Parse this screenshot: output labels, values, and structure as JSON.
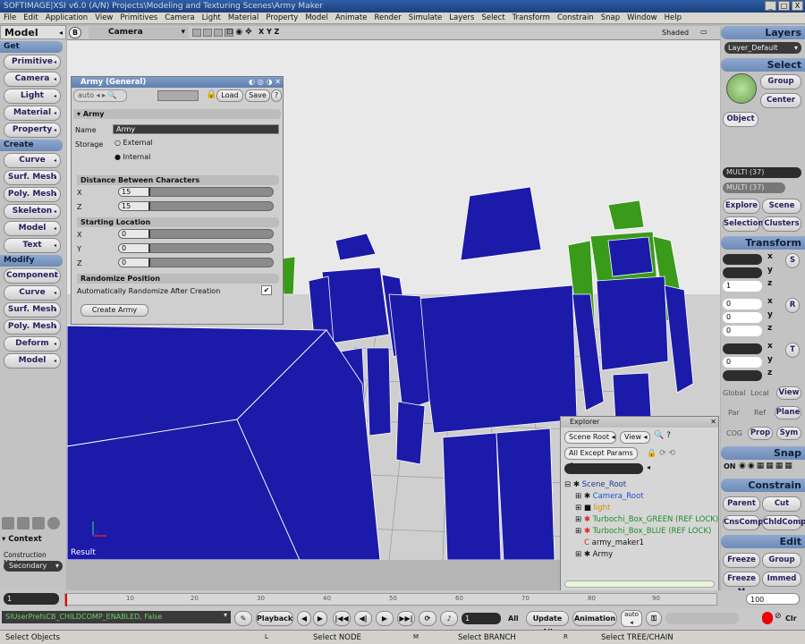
{
  "window": {
    "title": "SOFTIMAGE|XSI v6.0 (A/N) Projects\\Modeling and Texturing Scenes\\Army Maker",
    "min": "_",
    "max": "□",
    "close": "X"
  },
  "menu": [
    "File",
    "Edit",
    "Application",
    "View",
    "Primitives",
    "Camera",
    "Light",
    "Material",
    "Property",
    "Model",
    "Animate",
    "Render",
    "Simulate",
    "Layers",
    "Select",
    "Transform",
    "Constrain",
    "Snap",
    "Window",
    "Help"
  ],
  "left": {
    "title": "Model",
    "get": "Get",
    "get_items": [
      "Primitive",
      "Camera",
      "Light",
      "Material",
      "Property"
    ],
    "create": "Create",
    "create_items": [
      "Curve",
      "Surf. Mesh",
      "Poly. Mesh",
      "Skeleton",
      "Model",
      "Text"
    ],
    "modify": "Modify",
    "modify_items": [
      "Component",
      "Curve",
      "Surf. Mesh",
      "Poly. Mesh",
      "Deform",
      "Model"
    ],
    "context": "Context",
    "construction_mode_label": "Construction Mode",
    "construction_mode": "Secondary"
  },
  "viewport": {
    "letter": "B",
    "camera": "Camera",
    "axes": "X Y Z",
    "shading": "Shaded",
    "result": "Result"
  },
  "prop_editor": {
    "title": "Army (General)",
    "auto": "auto",
    "load": "Load",
    "save": "Save",
    "help": "?",
    "section": "Army",
    "name_label": "Name",
    "name_value": "Army",
    "storage_label": "Storage",
    "storage_external": "External",
    "storage_internal": "Internal",
    "distance_section": "Distance Between Characters",
    "x_label": "X",
    "z_label": "Z",
    "y_label": "Y",
    "dist_x": "15",
    "dist_z": "15",
    "dist_x_level": 0.19,
    "dist_z_level": 0.19,
    "start_section": "Starting Location",
    "start_x": "0",
    "start_y": "0",
    "start_z": "0",
    "start_level": 0.19,
    "random_section": "Randomize Position",
    "random_label": "Automatically Randomize After Creation",
    "random_checked": "✔",
    "create_button": "Create Army"
  },
  "right": {
    "layers": "Layers",
    "layer_value": "Layer_Default",
    "select": "Select",
    "group": "Group",
    "center": "Center",
    "object": "Object",
    "multi1": "MULTI (37)",
    "multi2": "MULTI (37)",
    "explore": "Explore",
    "scene": "Scene",
    "selection": "Selection",
    "clusters": "Clusters",
    "transform": "Transform",
    "axis_x": "x",
    "axis_y": "y",
    "axis_z": "z",
    "s_label": "S",
    "r_label": "R",
    "t_label": "T",
    "scale": [
      "",
      "",
      "1"
    ],
    "rot": [
      "0",
      "0",
      "0"
    ],
    "trans": [
      "",
      "0",
      ""
    ],
    "global": "Global",
    "local": "Local",
    "view": "View",
    "par": "Par",
    "ref": "Ref",
    "plane": "Plane",
    "cog": "COG",
    "prop": "Prop",
    "sym": "Sym",
    "snap": "Snap",
    "on": "ON",
    "constrain": "Constrain",
    "parent": "Parent",
    "cut": "Cut",
    "cnscomp": "CnsComp",
    "chldcomp": "ChldComp",
    "edit": "Edit",
    "freeze": "Freeze",
    "group2": "Group",
    "freeze_m": "Freeze M",
    "immed": "Immed"
  },
  "explorer": {
    "title": "Explorer",
    "scope": "Scene Root",
    "view": "View",
    "filter": "All Except Params",
    "items": [
      {
        "label": "Scene_Root",
        "color": "#1b3a8a"
      },
      {
        "label": "Camera_Root",
        "color": "#1b55c9"
      },
      {
        "label": "light",
        "color": "#d98a00"
      },
      {
        "label": "Turbochi_Box_GREEN (REF LOCK)",
        "color": "#1f8a2a"
      },
      {
        "label": "Turbochi_Box_BLUE (REF LOCK)",
        "color": "#1f8a2a"
      },
      {
        "label": "army_maker1",
        "color": "#111111"
      },
      {
        "label": "Army",
        "color": "#111111"
      }
    ]
  },
  "timeline": {
    "start": "1",
    "end": "100",
    "ticks": [
      "1",
      "10",
      "20",
      "30",
      "40",
      "50",
      "60",
      "70",
      "80",
      "90"
    ]
  },
  "playback": {
    "command": "SIUserPrefsCB_CHILDCOMP_ENABLED, False",
    "playback": "Playback",
    "frame": "1",
    "all": "All",
    "update_all": "Update All",
    "animation": "Animation",
    "auto": "auto",
    "clr": "Clr"
  },
  "status": {
    "left": "Select Objects",
    "l": "L",
    "l_text": "Select NODE",
    "m": "M",
    "m_text": "Select BRANCH",
    "r": "R",
    "r_text": "Select TREE/CHAIN"
  },
  "colors": {
    "blue_mesh": "#1c1aa8",
    "green_mesh": "#3a9a1a"
  }
}
